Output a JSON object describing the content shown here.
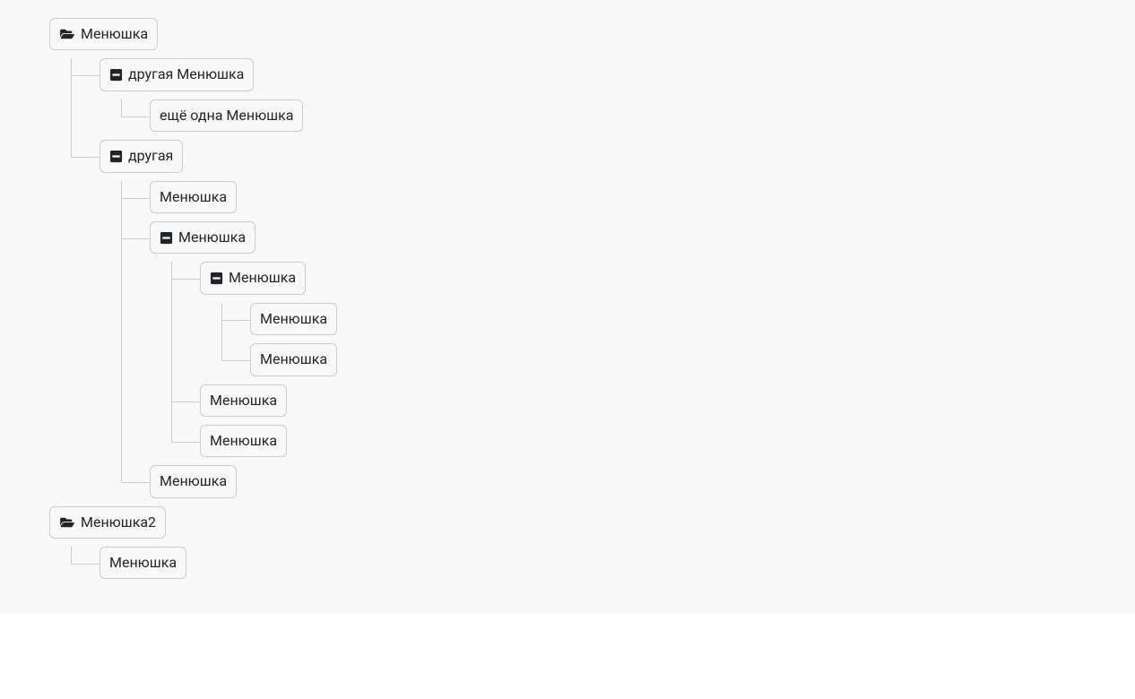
{
  "tree": [
    {
      "label": "Менюшка",
      "icon": "folder-open",
      "children": [
        {
          "label": "другая Менюшка",
          "icon": "minus-square",
          "children": [
            {
              "label": "ещё одна Менюшка",
              "icon": null,
              "children": []
            }
          ]
        },
        {
          "label": "другая",
          "icon": "minus-square",
          "children": [
            {
              "label": "Менюшка",
              "icon": null,
              "children": []
            },
            {
              "label": "Менюшка",
              "icon": "minus-square",
              "children": [
                {
                  "label": "Менюшка",
                  "icon": "minus-square",
                  "children": [
                    {
                      "label": "Менюшка",
                      "icon": null,
                      "children": []
                    },
                    {
                      "label": "Менюшка",
                      "icon": null,
                      "children": []
                    }
                  ]
                },
                {
                  "label": "Менюшка",
                  "icon": null,
                  "children": []
                },
                {
                  "label": "Менюшка",
                  "icon": null,
                  "children": []
                }
              ]
            },
            {
              "label": "Менюшка",
              "icon": null,
              "children": []
            }
          ]
        }
      ]
    },
    {
      "label": "Менюшка2",
      "icon": "folder-open",
      "children": [
        {
          "label": "Менюшка",
          "icon": null,
          "children": []
        }
      ]
    }
  ]
}
